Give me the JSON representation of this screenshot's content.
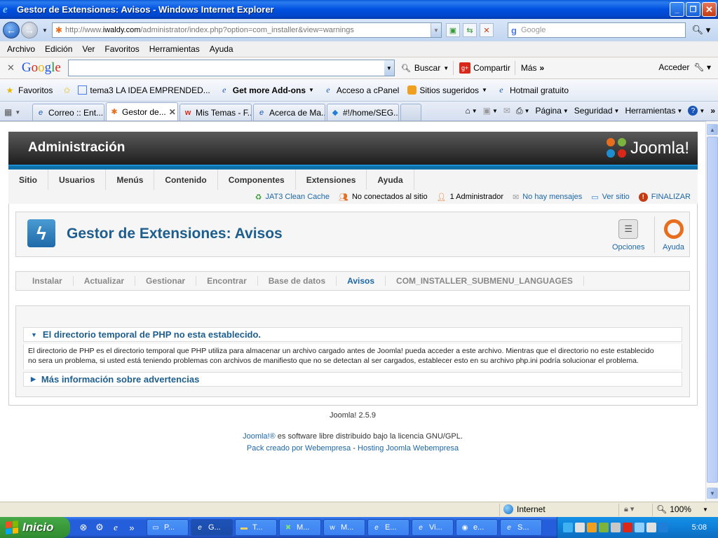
{
  "window": {
    "title": "Gestor de Extensiones: Avisos - Windows Internet Explorer",
    "controls": {
      "minimize": "_",
      "maximize": "❐",
      "close": "✕"
    }
  },
  "address_bar": {
    "url_prefix": "http://www.",
    "url_host": "iwaldy.com",
    "url_path": "/administrator/index.php?option=com_installer&view=warnings",
    "search_placeholder": "Google",
    "search_engine_label": "g"
  },
  "menubar": {
    "items": [
      "Archivo",
      "Edición",
      "Ver",
      "Favoritos",
      "Herramientas",
      "Ayuda"
    ]
  },
  "google_toolbar": {
    "logo": [
      "G",
      "o",
      "o",
      "g",
      "l",
      "e"
    ],
    "search_value": "",
    "buttons": [
      "Buscar",
      "Compartir",
      "Más"
    ],
    "sign_in": "Acceder"
  },
  "favorites_bar": {
    "label": "Favoritos",
    "items": [
      {
        "label": "tema3 LA IDEA EMPRENDED...",
        "icon": "page-icon",
        "bold": false,
        "dropdown": false
      },
      {
        "label": "Get more Add-ons",
        "icon": "ie-icon",
        "bold": true,
        "dropdown": true
      },
      {
        "label": "Acceso a cPanel",
        "icon": "ie-icon",
        "bold": false,
        "dropdown": false
      },
      {
        "label": "Sitios sugeridos",
        "icon": "suggested-sites-icon",
        "bold": false,
        "dropdown": true
      },
      {
        "label": "Hotmail gratuito",
        "icon": "ie-icon",
        "bold": false,
        "dropdown": false
      }
    ]
  },
  "tabs": {
    "items": [
      {
        "label": "Correo :: Ent...",
        "icon": "ie-icon",
        "active": false
      },
      {
        "label": "Gestor de...",
        "icon": "joomla-icon",
        "active": true
      },
      {
        "label": "Mis Temas - F...",
        "icon": "w-icon",
        "active": false
      },
      {
        "label": "Acerca de Ma...",
        "icon": "ie-icon",
        "active": false
      },
      {
        "label": "#!/home/SEG...",
        "icon": "dropbox-icon",
        "active": false
      }
    ],
    "close_glyph": "✕"
  },
  "command_bar": {
    "items": [
      "Página",
      "Seguridad",
      "Herramientas"
    ]
  },
  "joomla": {
    "header_title": "Administración",
    "logo_text": "Joomla!",
    "nav": [
      "Sitio",
      "Usuarios",
      "Menús",
      "Contenido",
      "Componentes",
      "Extensiones",
      "Ayuda"
    ],
    "status": [
      {
        "label": "JAT3 Clean Cache",
        "link": true,
        "icon": "recycle-icon"
      },
      {
        "label": "No conectados al sitio",
        "link": false,
        "icon": "users-icon"
      },
      {
        "label": "1 Administrador",
        "link": false,
        "icon": "user-icon"
      },
      {
        "label": "No hay mensajes",
        "link": true,
        "icon": "mail-icon"
      },
      {
        "label": "Ver sitio",
        "link": true,
        "icon": "monitor-icon"
      },
      {
        "label": "FINALIZAR",
        "link": true,
        "icon": "logout-icon"
      }
    ],
    "page_title": "Gestor de Extensiones: Avisos",
    "toolbar": {
      "options": "Opciones",
      "help": "Ayuda"
    },
    "submenu": [
      {
        "label": "Instalar",
        "active": false
      },
      {
        "label": "Actualizar",
        "active": false
      },
      {
        "label": "Gestionar",
        "active": false
      },
      {
        "label": "Encontrar",
        "active": false
      },
      {
        "label": "Base de datos",
        "active": false
      },
      {
        "label": "Avisos",
        "active": true
      },
      {
        "label": "COM_INSTALLER_SUBMENU_LANGUAGES",
        "active": false
      }
    ],
    "warnings": [
      {
        "title": "El directorio temporal de PHP no esta establecido.",
        "expanded": true,
        "body_line1": "El directorio de PHP es el directorio temporal que PHP utiliza para almacenar un archivo cargado antes de Joomla! pueda acceder a este archivo. Mientras que el directorio no este establecido",
        "body_line2": "no sera un problema, si usted está teniendo problemas con archivos de manifiesto que no se detectan al ser cargados, establecer esto en su archivo php.ini podría solucionar el problema."
      },
      {
        "title": "Más información sobre advertencias",
        "expanded": false
      }
    ],
    "footer": {
      "version": "Joomla! 2.5.9",
      "license_link": "Joomla!®",
      "license_text": " es software libre distribuido bajo la licencia GNU/GPL.",
      "pack_link": "Pack creado por Webempresa",
      "separator": " - ",
      "hosting_link": "Hosting Joomla Webempresa"
    }
  },
  "statusbar": {
    "zone": "Internet",
    "zoom": "100%"
  },
  "taskbar": {
    "start_label": "Inicio",
    "tasks": [
      {
        "label": "P...",
        "icon": "window-icon",
        "active": false
      },
      {
        "label": "G...",
        "icon": "ie-icon",
        "active": true
      },
      {
        "label": "T...",
        "icon": "folder-icon",
        "active": false
      },
      {
        "label": "M...",
        "icon": "excel-icon",
        "active": false
      },
      {
        "label": "M...",
        "icon": "w-icon",
        "active": false
      },
      {
        "label": "E...",
        "icon": "ie-icon",
        "active": false
      },
      {
        "label": "Vi...",
        "icon": "ie-icon",
        "active": false
      },
      {
        "label": "e...",
        "icon": "app-icon",
        "active": false
      },
      {
        "label": "S...",
        "icon": "ie-icon",
        "active": false
      }
    ],
    "clock": "5:08"
  },
  "colors": {
    "joomla_blue": "#1D5E8E",
    "link_blue": "#1C66A8",
    "xp_title_blue": "#0050E0",
    "taskbar_blue": "#245EDB",
    "start_green": "#3A9A3A"
  }
}
